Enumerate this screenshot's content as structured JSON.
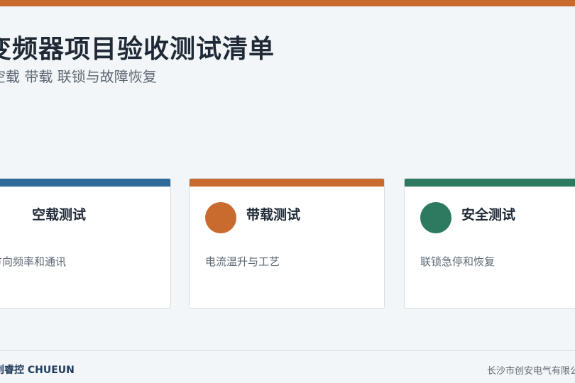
{
  "colors": {
    "accent_orange": "#c96a2f",
    "accent_blue": "#2f6b9a",
    "accent_green": "#2d7a60",
    "background": "#f3f6f8",
    "title_text": "#1f2a36"
  },
  "header": {
    "title": "变频器项目验收测试清单",
    "subtitle": "空载 带载 联锁与故障恢复"
  },
  "cards": [
    {
      "title": "空载测试",
      "description": "方向频率和通讯"
    },
    {
      "title": "带载测试",
      "description": "电流温升与工艺"
    },
    {
      "title": "安全测试",
      "description": "联锁急停和恢复"
    }
  ],
  "footer": {
    "brand": "创睿控 CHUEUN",
    "company": "长沙市创安电气有限公司"
  }
}
